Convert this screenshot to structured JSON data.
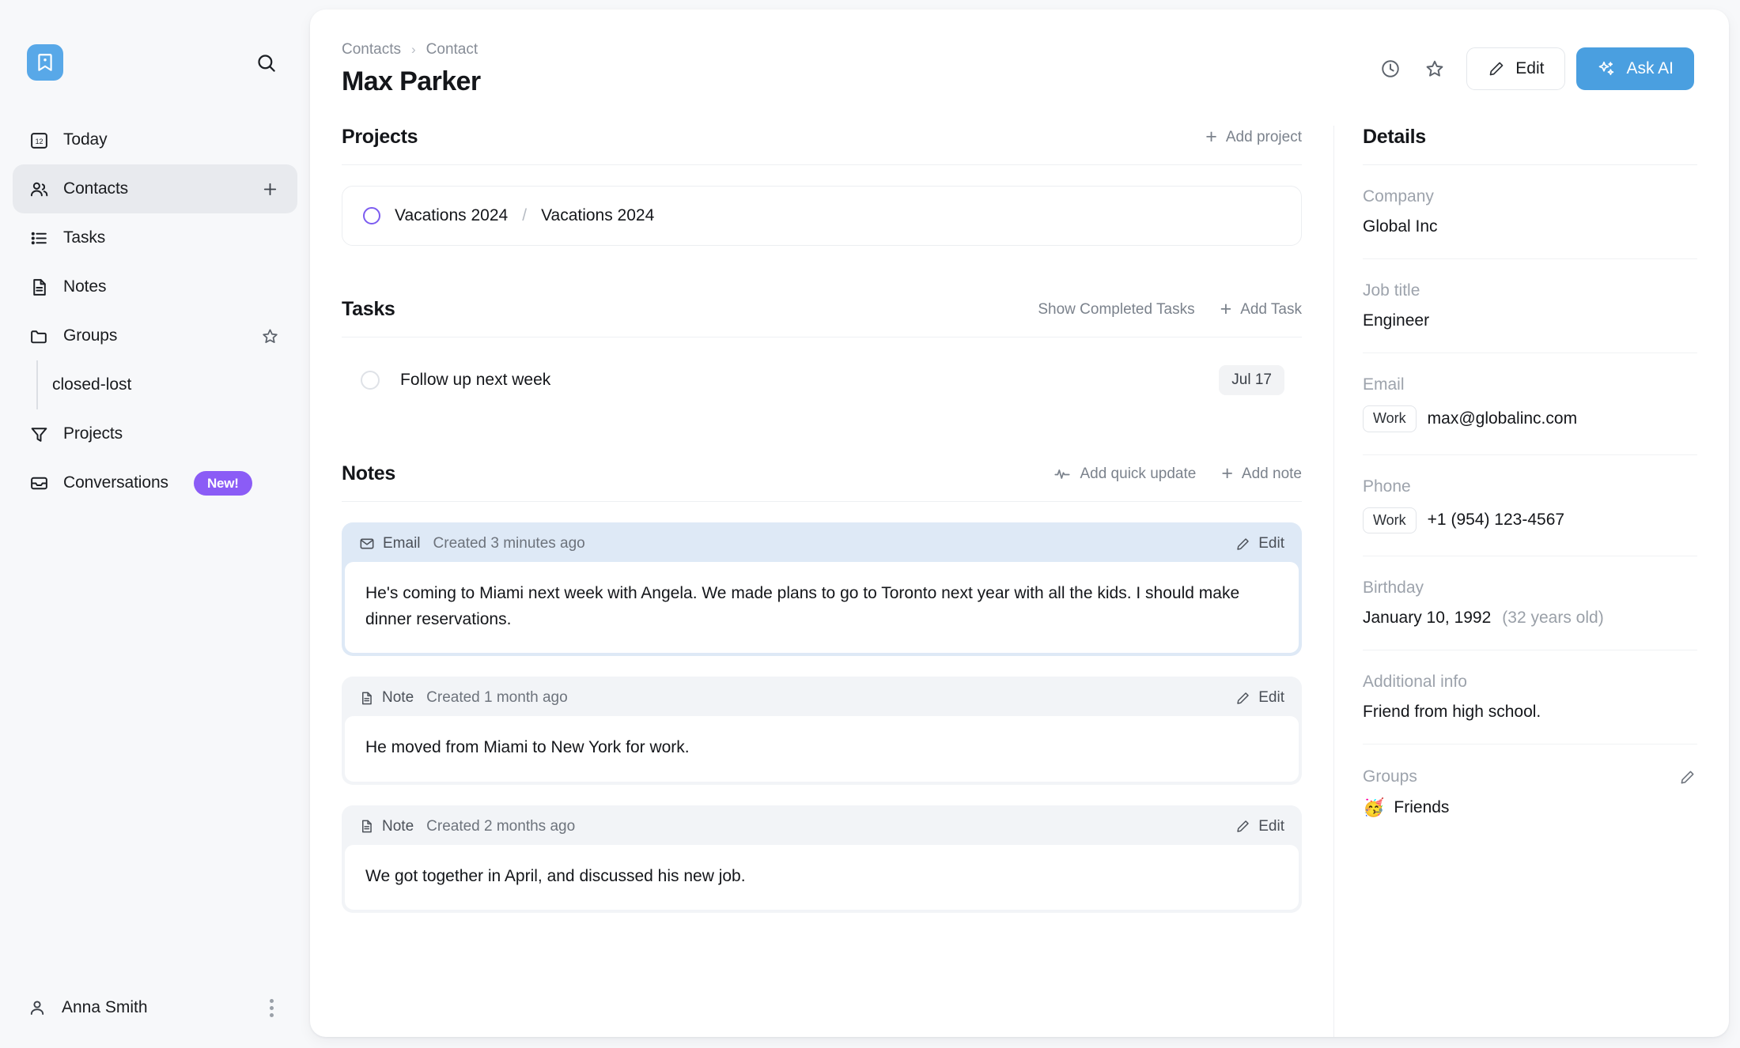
{
  "sidebar": {
    "logo_icon": "bookmark-icon",
    "search_icon": "search-icon",
    "items": [
      {
        "label": "Today",
        "icon": "calendar-12-icon"
      },
      {
        "label": "Contacts",
        "icon": "users-icon",
        "trailing_icon": "plus-icon"
      },
      {
        "label": "Tasks",
        "icon": "list-icon"
      },
      {
        "label": "Notes",
        "icon": "document-icon"
      },
      {
        "label": "Groups",
        "icon": "folder-icon",
        "trailing_icon": "star-icon"
      },
      {
        "label": "Projects",
        "icon": "funnel-icon"
      },
      {
        "label": "Conversations",
        "icon": "inbox-icon",
        "badge": "New!"
      }
    ],
    "subitem": {
      "label": "closed-lost"
    },
    "user": {
      "name": "Anna Smith",
      "icon": "person-icon",
      "menu_icon": "more-vertical-icon"
    }
  },
  "header": {
    "breadcrumb": {
      "parent": "Contacts",
      "separator": "›",
      "current": "Contact"
    },
    "title": "Max Parker",
    "actions": {
      "history_icon": "clock-icon",
      "favorite_icon": "star-icon",
      "edit_label": "Edit",
      "edit_icon": "pencil-icon",
      "ask_ai_label": "Ask AI",
      "ask_ai_icon": "sparkles-icon"
    }
  },
  "projects": {
    "title": "Projects",
    "add_label": "Add project",
    "add_icon": "plus-icon",
    "items": [
      {
        "name": "Vacations 2024",
        "separator": "/",
        "stage": "Vacations 2024",
        "status_color": "#7c5cf0"
      }
    ]
  },
  "tasks": {
    "title": "Tasks",
    "show_completed_label": "Show Completed Tasks",
    "add_label": "Add Task",
    "add_icon": "plus-icon",
    "items": [
      {
        "label": "Follow up next week",
        "date": "Jul 17",
        "checkbox_icon": "circle-unchecked-icon"
      }
    ]
  },
  "notes": {
    "title": "Notes",
    "quick_update_label": "Add quick update",
    "quick_update_icon": "activity-icon",
    "add_label": "Add note",
    "add_icon": "plus-icon",
    "edit_label": "Edit",
    "edit_icon": "pencil-icon",
    "items": [
      {
        "kind": "Email",
        "kind_icon": "envelope-icon",
        "created": "Created 3 minutes ago",
        "body": "He's coming to Miami next week with Angela. We made plans to go to Toronto next year with all the kids. I should make dinner reservations.",
        "highlight": true
      },
      {
        "kind": "Note",
        "kind_icon": "document-icon",
        "created": "Created 1 month ago",
        "body": "He moved from Miami to New York for work.",
        "highlight": false
      },
      {
        "kind": "Note",
        "kind_icon": "document-icon",
        "created": "Created 2 months ago",
        "body": "We got together in April, and discussed his new job.",
        "highlight": false
      }
    ]
  },
  "details": {
    "title": "Details",
    "company": {
      "label": "Company",
      "value": "Global Inc"
    },
    "job_title": {
      "label": "Job title",
      "value": "Engineer"
    },
    "email": {
      "label": "Email",
      "chip": "Work",
      "value": "max@globalinc.com"
    },
    "phone": {
      "label": "Phone",
      "chip": "Work",
      "value": "+1 (954) 123-4567"
    },
    "birthday": {
      "label": "Birthday",
      "value": "January 10, 1992",
      "age": "(32 years old)"
    },
    "additional_info": {
      "label": "Additional info",
      "value": "Friend from high school."
    },
    "groups": {
      "label": "Groups",
      "edit_icon": "pencil-icon",
      "items": [
        {
          "emoji": "🥳",
          "name": "Friends"
        }
      ]
    }
  },
  "colors": {
    "accent_blue": "#4a9fe0",
    "badge_purple": "#8b5cf6",
    "project_purple": "#7c5cf0",
    "email_card_bg": "#dee9f6",
    "note_card_bg": "#f2f4f7"
  }
}
